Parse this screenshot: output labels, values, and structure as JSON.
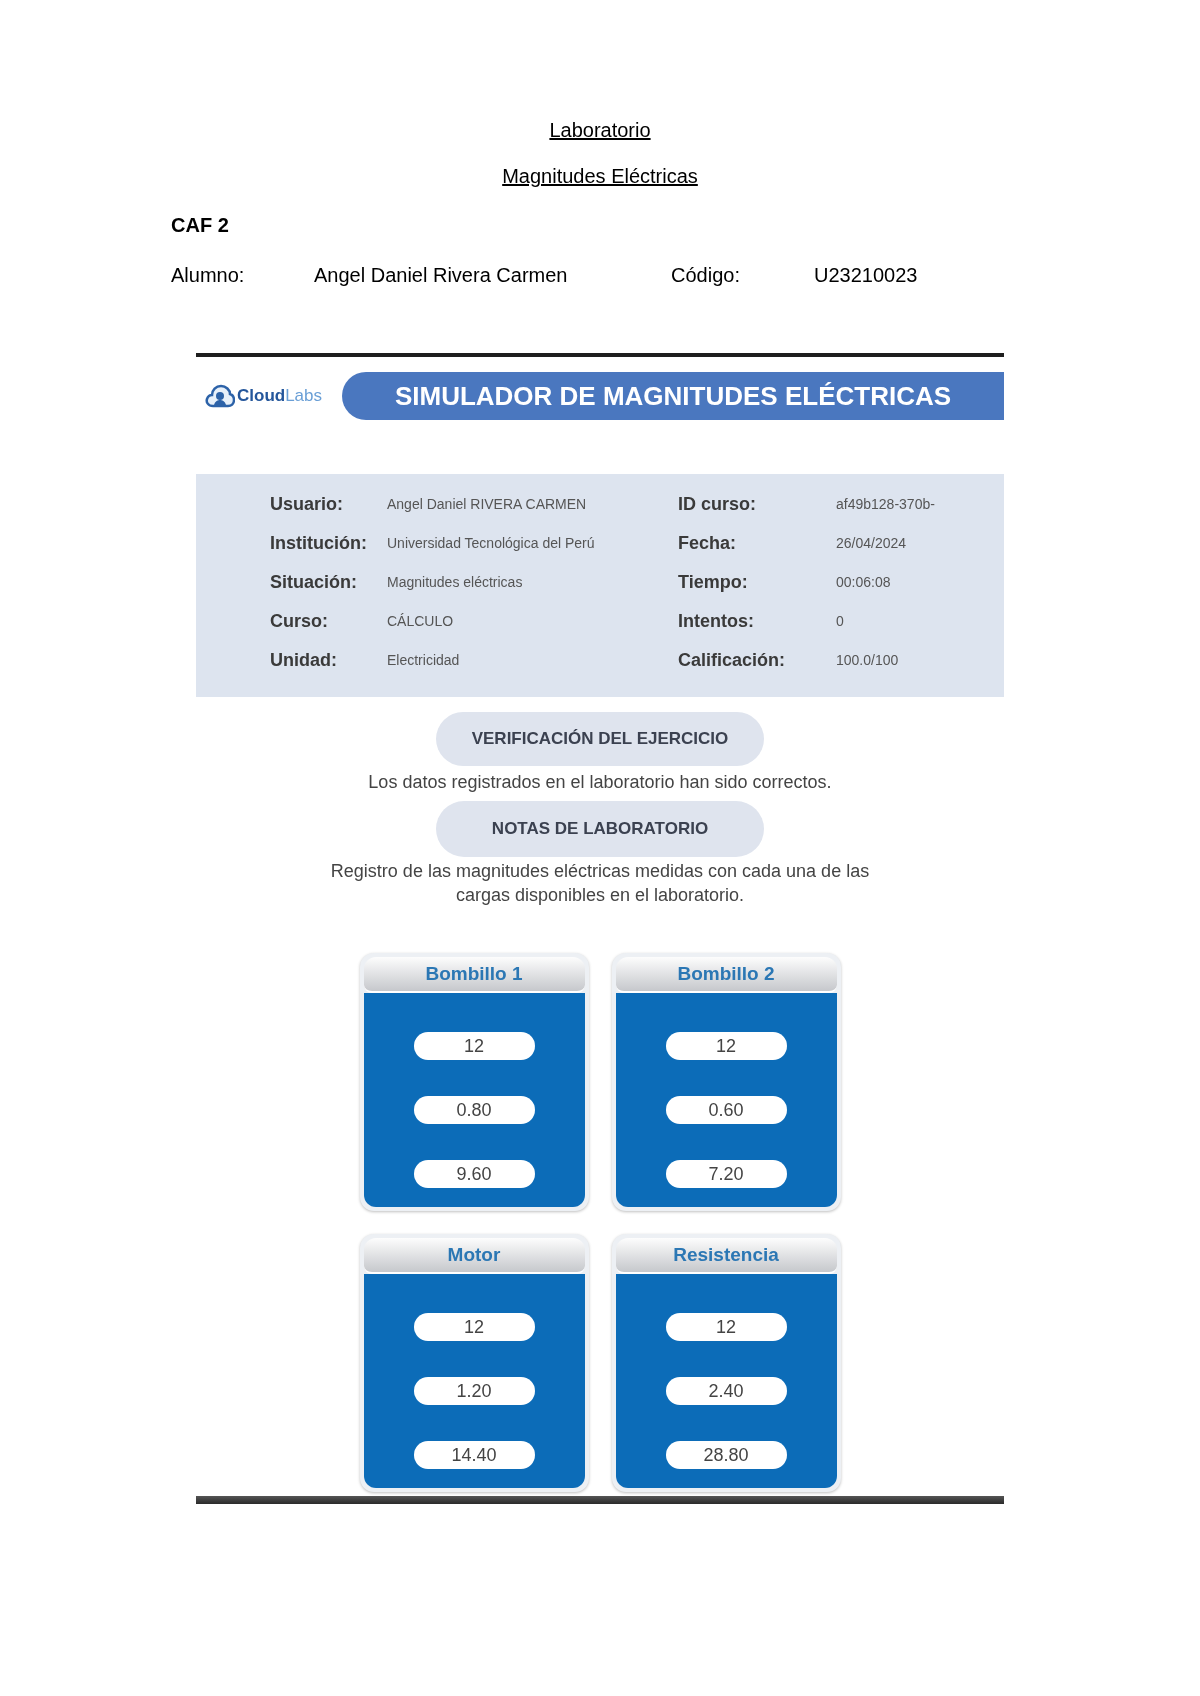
{
  "document": {
    "title": "Laboratorio",
    "subtitle": "Magnitudes Eléctricas",
    "group": "CAF 2",
    "student_label": "Alumno:",
    "student_name": "Angel Daniel Rivera Carmen",
    "code_label": "Código:",
    "code": "U23210023"
  },
  "simulator": {
    "logo": "**Cloud**Labs",
    "banner_title": "SIMULADOR DE MAGNITUDES ELÉCTRICAS",
    "user_info": [
      {
        "label": "Usuario:",
        "value": "Angel Daniel RIVERA CARMEN"
      },
      {
        "label": "Institución:",
        "value": "Universidad Tecnológica del Perú"
      },
      {
        "label": "Situación:",
        "value": "Magnitudes eléctricas"
      },
      {
        "label": "Curso:",
        "value": "CÁLCULO"
      },
      {
        "label": "Unidad:",
        "value": "Electricidad"
      }
    ],
    "course_info": [
      {
        "label": "ID curso:",
        "value": "af49b128-370b-"
      },
      {
        "label": "Fecha:",
        "value": "26/04/2024"
      },
      {
        "label": "Tiempo:",
        "value": "00:06:08"
      },
      {
        "label": "Intentos:",
        "value": "0"
      },
      {
        "label": "Calificación:",
        "value": "100.0/100"
      }
    ],
    "verification": {
      "button": "VERIFICACIÓN DEL EJERCICIO",
      "message": "Los datos registrados en el laboratorio han sido correctos."
    },
    "notes": {
      "button": "NOTAS DE LABORATORIO",
      "message": "Registro de las magnitudes eléctricas medidas con cada una de las cargas disponibles en el laboratorio."
    },
    "loads": [
      {
        "name": "Bombillo 1",
        "values": [
          "12",
          "0.80",
          "9.60"
        ]
      },
      {
        "name": "Bombillo 2",
        "values": [
          "12",
          "0.60",
          "7.20"
        ]
      },
      {
        "name": "Motor",
        "values": [
          "12",
          "1.20",
          "14.40"
        ]
      },
      {
        "name": "Resistencia",
        "values": [
          "12",
          "2.40",
          "28.80"
        ]
      }
    ]
  }
}
